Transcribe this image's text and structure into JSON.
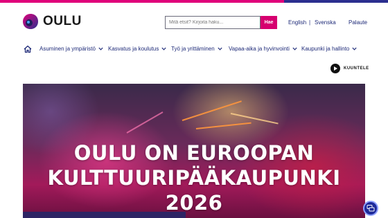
{
  "header": {
    "logo_text": "OULU",
    "search": {
      "placeholder": "Mitä etsit? Kirjoita haku...",
      "button_label": "Hae"
    },
    "languages": [
      {
        "label": "English"
      },
      {
        "label": "Svenska"
      }
    ],
    "language_separator": "|",
    "feedback_label": "Palaute"
  },
  "nav": {
    "items": [
      {
        "label": "Asuminen ja ympäristö"
      },
      {
        "label": "Kasvatus ja koulutus"
      },
      {
        "label": "Työ ja yrittäminen"
      },
      {
        "label": "Vapaa-aika ja hyvinvointi"
      },
      {
        "label": "Kaupunki ja hallinto"
      }
    ]
  },
  "listen": {
    "label": "KUUNTELE",
    "icon": "play-icon"
  },
  "hero": {
    "title_lines": [
      "OULU ON EUROOPAN",
      "KULTTUURIPÄÄKAUPUNKI",
      "2026"
    ]
  },
  "colors": {
    "accent": "#d6006f",
    "nav_text": "#1e2a78",
    "help_button": "#1e2a9a"
  }
}
